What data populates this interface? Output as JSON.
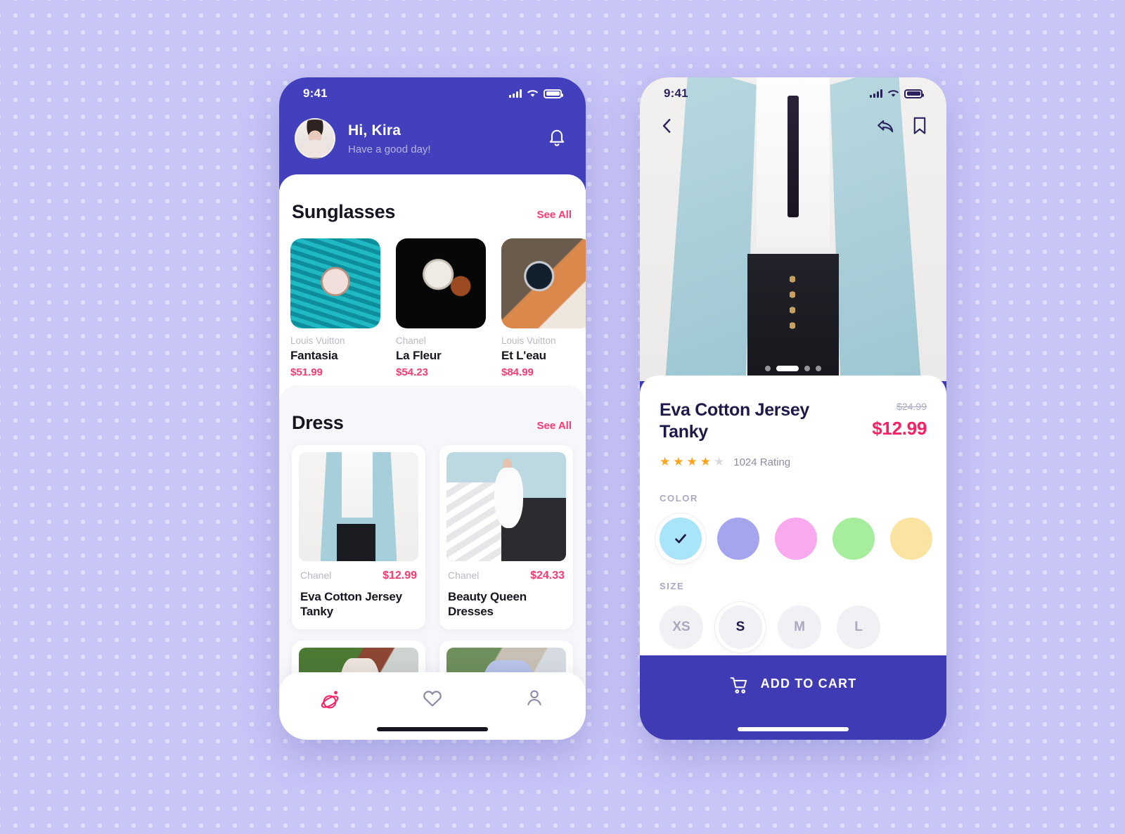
{
  "background": {
    "color": "#c8c6f7",
    "pattern": "dot-grid"
  },
  "theme": {
    "primary": "#4340bd",
    "accent_pink": "#fb3a72",
    "price_pink": "#fb1f63",
    "dark_text": "#1d1a4a"
  },
  "home_screen": {
    "status_bar": {
      "time": "9:41",
      "signal": "cellular-signal-icon",
      "wifi": "wifi-icon",
      "battery": "battery-icon"
    },
    "header": {
      "greeting": "Hi, Kira",
      "subtitle": "Have a good day!",
      "avatar": "user-avatar",
      "notification_icon": "bell-icon"
    },
    "sections": [
      {
        "title": "Sunglasses",
        "see_all": "See All",
        "products": [
          {
            "brand": "Louis Vuitton",
            "name": "Fantasia",
            "price": "$51.99",
            "thumb": "watch-rose-gold-on-teal"
          },
          {
            "brand": "Chanel",
            "name": "La Fleur",
            "price": "$54.23",
            "thumb": "watch-white-dial-black-bg"
          },
          {
            "brand": "Louis Vuitton",
            "name": "Et L'eau",
            "price": "$84.99",
            "thumb": "smartwatch-tan-strap"
          }
        ]
      },
      {
        "title": "Dress",
        "see_all": "See All",
        "products": [
          {
            "brand": "Chanel",
            "price": "$12.99",
            "name": "Eva Cotton Jersey Tanky",
            "thumb": "blue-blazer-black-skirt"
          },
          {
            "brand": "Chanel",
            "price": "$24.33",
            "name": "Beauty Queen Dresses",
            "thumb": "white-dress-on-stairs"
          },
          {
            "thumb": "floral-top-outdoor"
          },
          {
            "thumb": "blue-top-street"
          }
        ]
      }
    ],
    "tab_bar": {
      "items": [
        {
          "icon": "planet-icon",
          "active": true
        },
        {
          "icon": "heart-icon",
          "active": false
        },
        {
          "icon": "person-icon",
          "active": false
        }
      ]
    }
  },
  "detail_screen": {
    "status_bar": {
      "time": "9:41",
      "signal": "cellular-signal-icon",
      "wifi": "wifi-icon",
      "battery": "battery-icon"
    },
    "top_bar": {
      "back_icon": "chevron-left-icon",
      "share_icon": "share-reply-icon",
      "bookmark_icon": "bookmark-icon"
    },
    "gallery": {
      "image": "blue-blazer-black-skirt-model",
      "dots": 4,
      "active_dot": 1
    },
    "product": {
      "title": "Eva Cotton Jersey Tanky",
      "old_price": "$24.99",
      "price": "$12.99",
      "stars_filled": 4,
      "stars_total": 5,
      "rating_text": "1024 Rating"
    },
    "color": {
      "label": "COLOR",
      "options": [
        {
          "name": "light-blue",
          "hex": "#a8e5fa",
          "selected": true
        },
        {
          "name": "periwinkle",
          "hex": "#a5a5ef",
          "selected": false
        },
        {
          "name": "pink",
          "hex": "#f9a9ee",
          "selected": false
        },
        {
          "name": "green",
          "hex": "#a6ee9d",
          "selected": false
        },
        {
          "name": "yellow",
          "hex": "#fbe3a1",
          "selected": false
        }
      ]
    },
    "size": {
      "label": "SIZE",
      "options": [
        {
          "label": "XS",
          "selected": false
        },
        {
          "label": "S",
          "selected": true
        },
        {
          "label": "M",
          "selected": false
        },
        {
          "label": "L",
          "selected": false
        }
      ]
    },
    "cart_button": {
      "label": "ADD TO CART",
      "icon": "shopping-cart-icon"
    }
  }
}
